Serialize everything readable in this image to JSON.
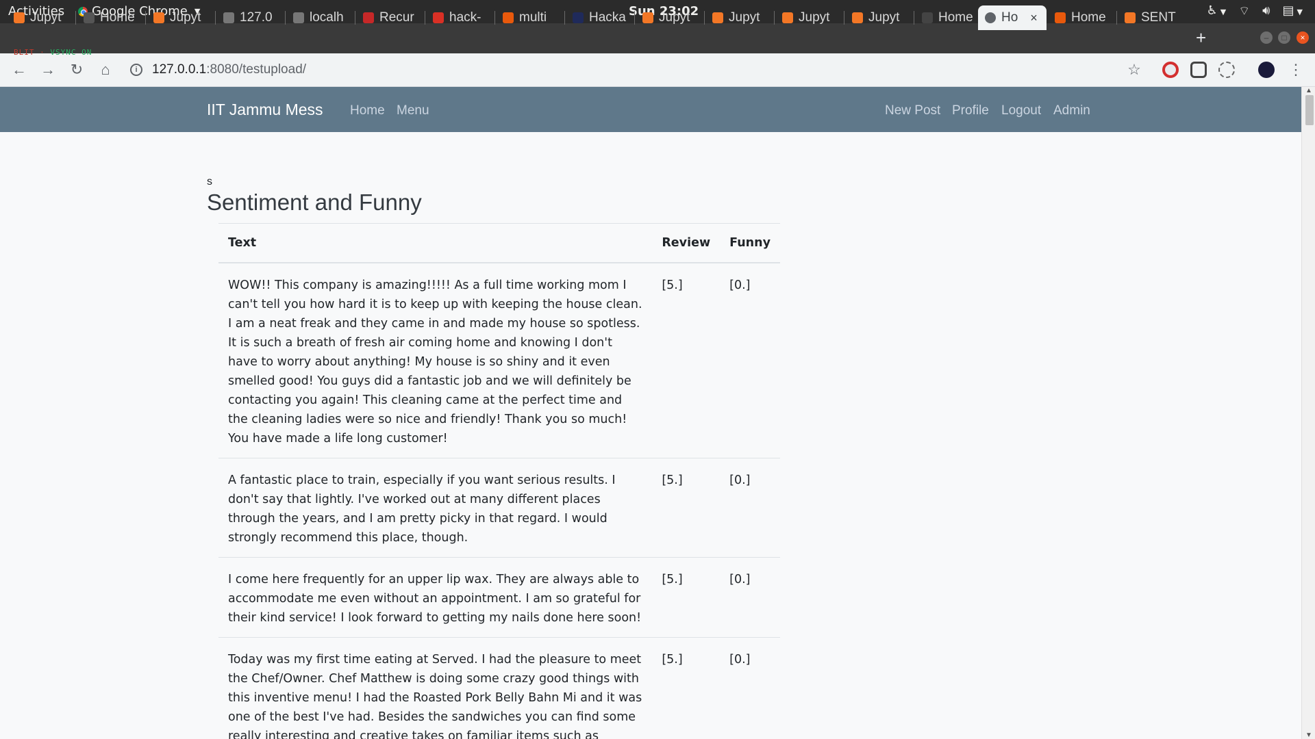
{
  "desktop": {
    "activities": "Activities",
    "app_name": "Google Chrome",
    "clock": "Sun 23:02"
  },
  "tabs": [
    {
      "label": "Jupyt",
      "color": "#f37726"
    },
    {
      "label": "Home",
      "color": "#555555"
    },
    {
      "label": "Jupyt",
      "color": "#f37726"
    },
    {
      "label": "127.0",
      "color": "#777777"
    },
    {
      "label": "localh",
      "color": "#777777"
    },
    {
      "label": "Recur",
      "color": "#c62828"
    },
    {
      "label": "hack-",
      "color": "#d93025"
    },
    {
      "label": "multi",
      "color": "#e8590c"
    },
    {
      "label": "Hacka",
      "color": "#1f2a5a"
    },
    {
      "label": "Jupyt",
      "color": "#f37726"
    },
    {
      "label": "Jupyt",
      "color": "#f37726"
    },
    {
      "label": "Jupyt",
      "color": "#f37726"
    },
    {
      "label": "Jupyt",
      "color": "#f37726"
    },
    {
      "label": "Home",
      "color": "#444444"
    },
    {
      "label": "Ho",
      "color": "#5f6368",
      "active": true
    },
    {
      "label": "Home",
      "color": "#e8590c"
    },
    {
      "label": "SENT",
      "color": "#f37726"
    }
  ],
  "overlay": {
    "left": "BLIT · ",
    "right": "VSYNC ON"
  },
  "address": {
    "host": "127.0.0.1",
    "rest": ":8080/testupload/"
  },
  "navbar": {
    "brand": "IIT Jammu Mess",
    "left_links": [
      "Home",
      "Menu"
    ],
    "right_links": [
      "New Post",
      "Profile",
      "Logout",
      "Admin"
    ]
  },
  "page": {
    "small_text": "s",
    "heading": "Sentiment and Funny",
    "columns": [
      "Text",
      "Review",
      "Funny"
    ],
    "rows": [
      {
        "text": "WOW!! This company is amazing!!!!! As a full time working mom I can't tell you how hard it is to keep up with keeping the house clean. I am a neat freak and they came in and made my house so spotless. It is such a breath of fresh air coming home and knowing I don't have to worry about anything! My house is so shiny and it even smelled good! You guys did a fantastic job and we will definitely be contacting you again! This cleaning came at the perfect time and the cleaning ladies were so nice and friendly! Thank you so much! You have made a life long customer!",
        "review": "[5.]",
        "funny": "[0.]"
      },
      {
        "text": "A fantastic place to train, especially if you want serious results. I don't say that lightly. I've worked out at many different places through the years, and I am pretty picky in that regard. I would strongly recommend this place, though.",
        "review": "[5.]",
        "funny": "[0.]"
      },
      {
        "text": "I come here frequently for an upper lip wax. They are always able to accommodate me even without an appointment. I am so grateful for their kind service! I look forward to getting my nails done here soon!",
        "review": "[5.]",
        "funny": "[0.]"
      },
      {
        "text": "Today was my first time eating at Served. I had the pleasure to meet the Chef/Owner. Chef Matthew is doing some crazy good things with this inventive menu! I had the Roasted Pork Belly Bahn Mi and it was one of the best I've had. Besides the sandwiches you can find some really interesting and creative takes on familiar items such as Oaxacan Braised Short Rib. This spot is worth your time!!!",
        "review": "[5.]",
        "funny": "[0.]"
      }
    ]
  },
  "colors": {
    "navbar": "#5f788a",
    "page_bg": "#f8f9fa",
    "topbar": "#2b2b2b"
  }
}
